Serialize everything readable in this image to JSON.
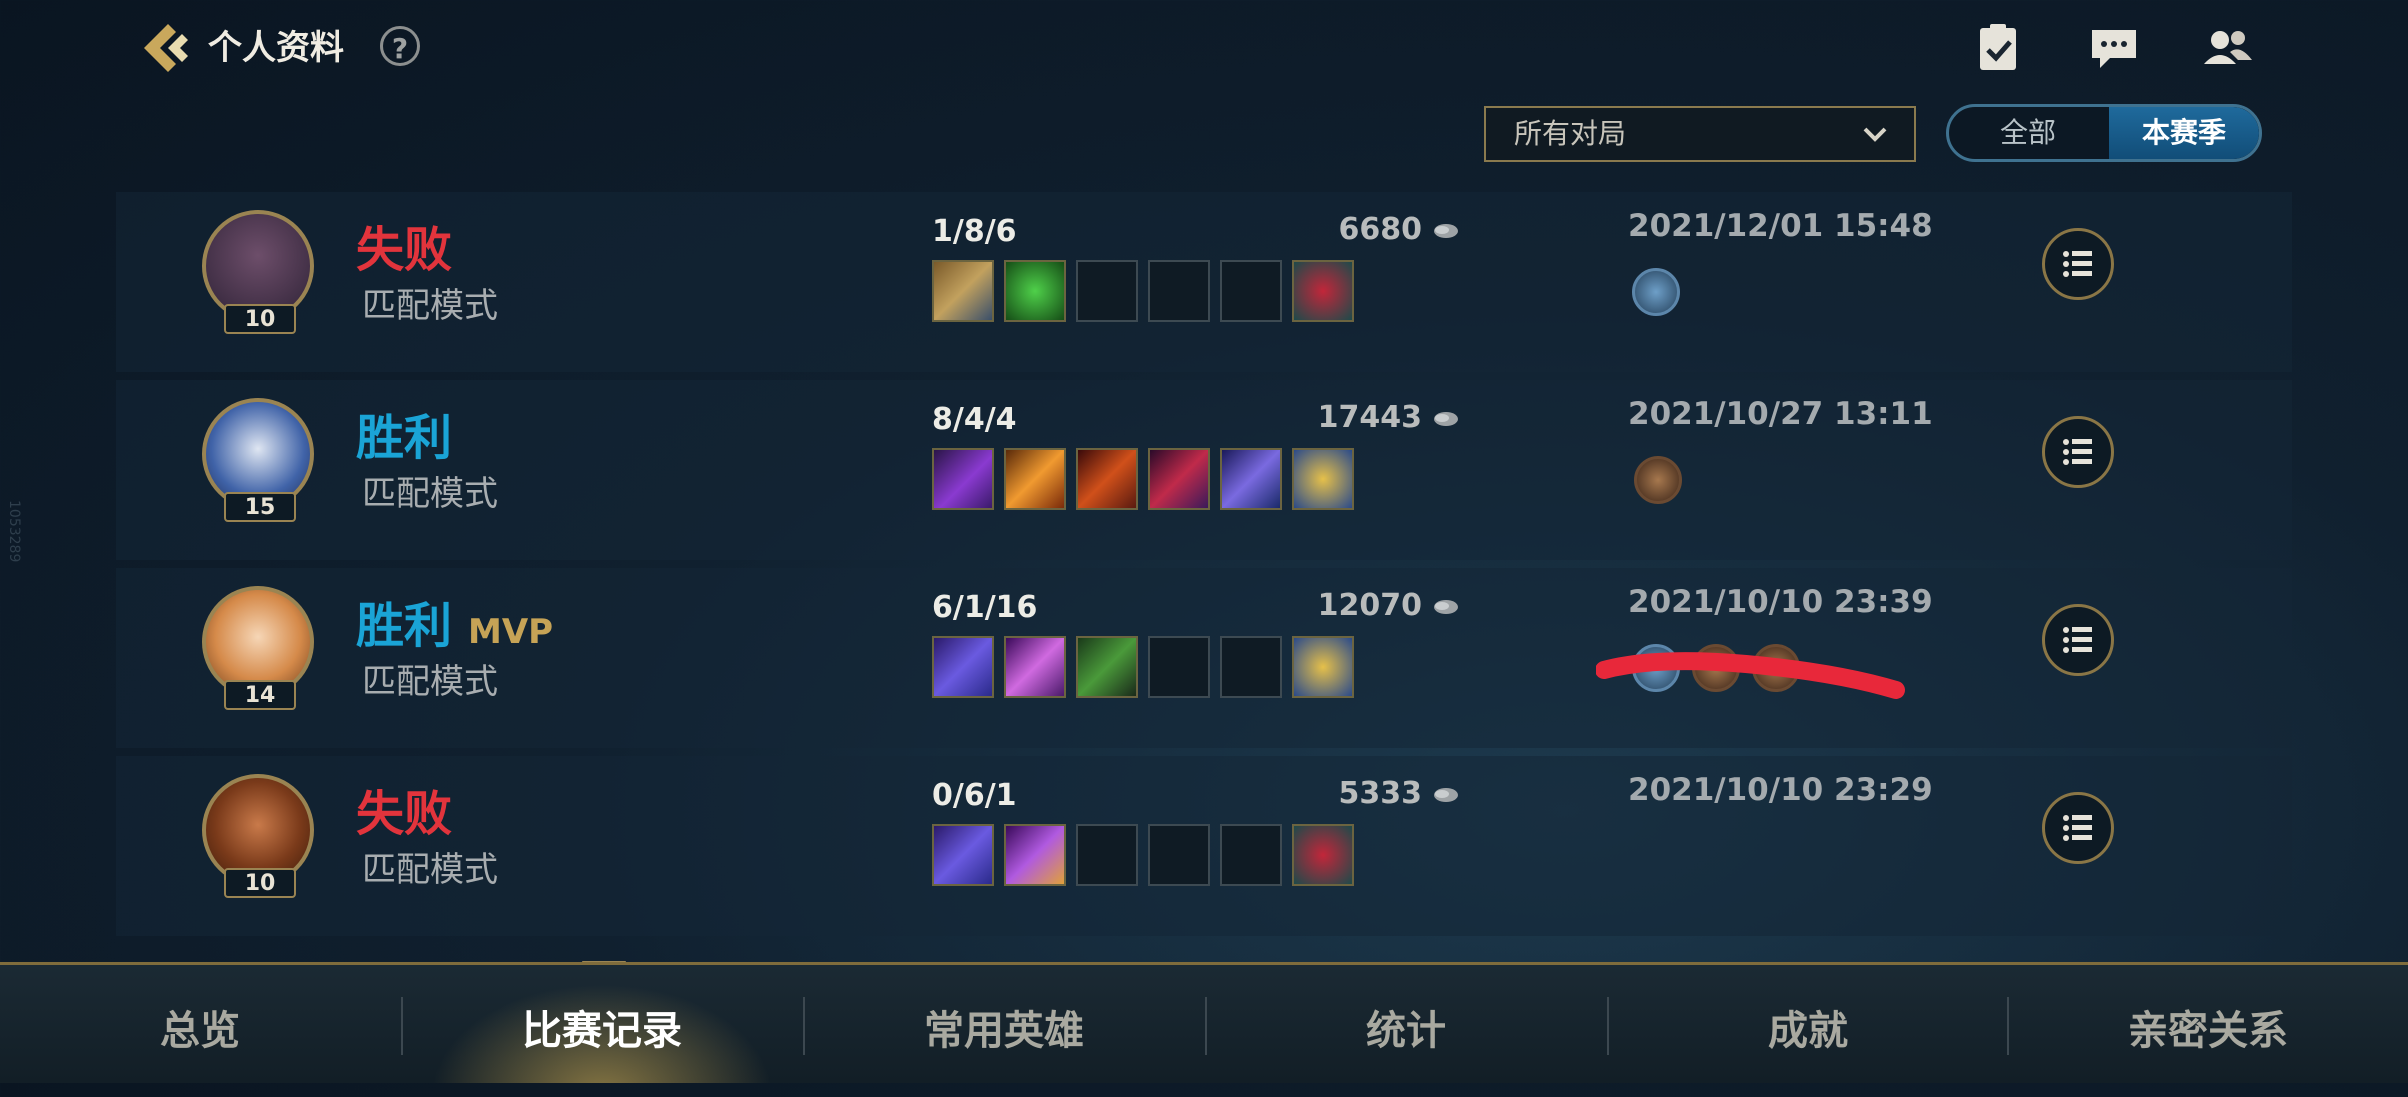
{
  "header": {
    "title": "个人资料",
    "help": "?"
  },
  "filter": {
    "selected": "所有对局",
    "seg_all": "全部",
    "seg_season": "本赛季"
  },
  "matches": [
    {
      "result": "失败",
      "result_color": "#e2343c",
      "mvp": "",
      "mode": "匹配模式",
      "level": "10",
      "kda": "1/8/6",
      "gold": "6680",
      "date": "2021/12/01 15:48"
    },
    {
      "result": "胜利",
      "result_color": "#1aa4d6",
      "mvp": "",
      "mode": "匹配模式",
      "level": "15",
      "kda": "8/4/4",
      "gold": "17443",
      "date": "2021/10/27 13:11"
    },
    {
      "result": "胜利",
      "result_color": "#1aa4d6",
      "mvp": "MVP",
      "mode": "匹配模式",
      "level": "14",
      "kda": "6/1/16",
      "gold": "12070",
      "date": "2021/10/10 23:39"
    },
    {
      "result": "失败",
      "result_color": "#e2343c",
      "mvp": "",
      "mode": "匹配模式",
      "level": "10",
      "kda": "0/6/1",
      "gold": "5333",
      "date": "2021/10/10 23:29"
    }
  ],
  "nav": {
    "items": [
      "总览",
      "比赛记录",
      "常用英雄",
      "统计",
      "成就",
      "亲密关系"
    ],
    "active": "比赛记录"
  },
  "icons": {
    "back": "back-arrow-icon",
    "missions": "checklist-icon",
    "chat": "chat-icon",
    "friends": "friends-icon",
    "gold": "gold-coin-icon",
    "details": "list-icon"
  },
  "colors": {
    "accent_gold": "#9a8452",
    "defeat": "#e2343c",
    "victory": "#1aa4d6",
    "active_tab": "#1f6a9c"
  },
  "watermark": "1053289"
}
